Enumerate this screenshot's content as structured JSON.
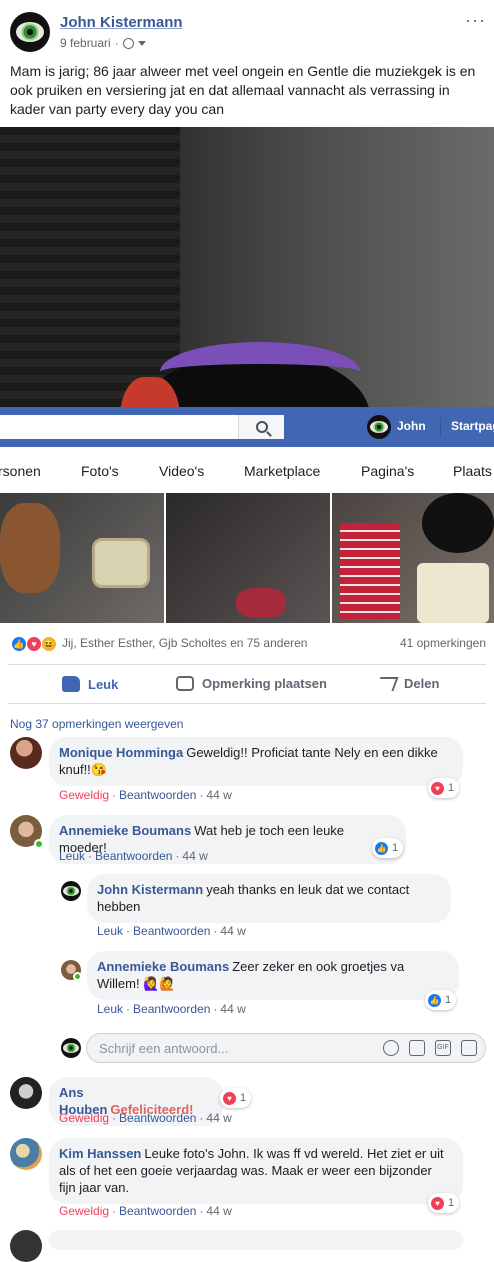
{
  "post": {
    "author": "John Kistermann",
    "date": "9 februari",
    "more_icon": "···",
    "text": "Mam is jarig; 86 jaar alweer met veel ongein en Gentle die muziekgek is en ook pruiken en versiering jat en dat allemaal vannacht als verrassing in kader van party every day you can"
  },
  "fb_bar": {
    "user_name": "John",
    "home_label": "Startpag"
  },
  "nav_tabs": [
    "rsonen",
    "Foto's",
    "Video's",
    "Marketplace",
    "Pagina's",
    "Plaats"
  ],
  "reactions": {
    "names": "Jij, Esther Esther, Gjb Scholtes en 75 anderen",
    "comments": "41 opmerkingen"
  },
  "actions": {
    "like": "Leuk",
    "comment": "Opmerking plaatsen",
    "share": "Delen"
  },
  "more_comments": "Nog 37 opmerkingen weergeven",
  "comments": [
    {
      "name": "Monique Homminga",
      "text": "Geweldig!! Proficiat tante Nely en een dikke knuf!!😘",
      "reaction_link": "Geweldig",
      "reply_link": "Beantwoorden",
      "time": "44 w",
      "badge_count": "1"
    },
    {
      "name": "Annemieke Boumans",
      "text": "Wat heb je toch een leuke moeder!",
      "reaction_link": "Leuk",
      "reply_link": "Beantwoorden",
      "time": "44 w",
      "badge_count": "1"
    },
    {
      "name": "John Kistermann",
      "text": "yeah thanks en leuk dat we contact hebben",
      "reaction_link": "Leuk",
      "reply_link": "Beantwoorden",
      "time": "44 w"
    },
    {
      "name": "Annemieke Boumans",
      "text": "Zeer zeker en ook groetjes va Willem! 🙋‍♀️🙋",
      "reaction_link": "Leuk",
      "reply_link": "Beantwoorden",
      "time": "44 w",
      "badge_count": "1"
    },
    {
      "name": "Ans Houben",
      "text": "Gefeliciteerd!",
      "reaction_link": "Geweldig",
      "reply_link": "Beantwoorden",
      "time": "44 w",
      "badge_count": "1"
    },
    {
      "name": "Kim Hanssen",
      "text": "Leuke foto's John. Ik was ff vd wereld. Het ziet er uit als of het een goeie verjaardag was. Maak er weer een bijzonder fijn jaar van.",
      "reaction_link": "Geweldig",
      "reply_link": "Beantwoorden",
      "time": "44 w",
      "badge_count": "1"
    }
  ],
  "reply_input": {
    "placeholder": "Schrijf een antwoord...",
    "icons": [
      "smiley-icon",
      "camera-icon",
      "gif-icon",
      "sticker-icon"
    ],
    "gif_label": "GIF"
  },
  "colors": {
    "fb_blue": "#4267b2",
    "link_blue": "#385898",
    "love_red": "#f33e58"
  }
}
